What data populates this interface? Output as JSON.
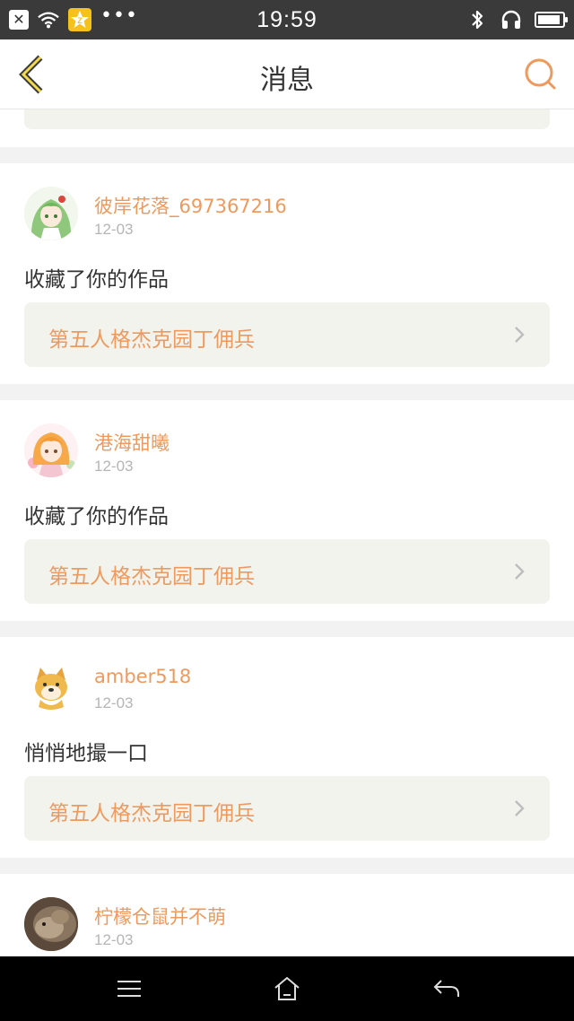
{
  "status_bar": {
    "time": "19:59",
    "qzone_letter": "Z",
    "more_dots": "•••",
    "close_glyph": "✕"
  },
  "header": {
    "title": "消息",
    "accent_color": "#ee9a5e"
  },
  "messages": [
    {
      "username": "彼岸花落_697367216",
      "date": "12-03",
      "action": "收藏了你的作品",
      "work_title": "第五人格杰克园丁佣兵",
      "avatar_icon": "green-haired-anime-avatar"
    },
    {
      "username": "港海甜曦",
      "date": "12-03",
      "action": "收藏了你的作品",
      "work_title": "第五人格杰克园丁佣兵",
      "avatar_icon": "orange-haired-anime-avatar"
    },
    {
      "username": "amber518",
      "date": "12-03",
      "action": "悄悄地撮一口",
      "work_title": "第五人格杰克园丁佣兵",
      "avatar_icon": "doge-avatar"
    },
    {
      "username": "柠檬仓鼠并不萌",
      "date": "12-03",
      "avatar_icon": "hamster-photo-avatar"
    }
  ],
  "nav_bar": {
    "icons": [
      "menu-icon",
      "home-icon",
      "back-arrow-icon"
    ]
  }
}
